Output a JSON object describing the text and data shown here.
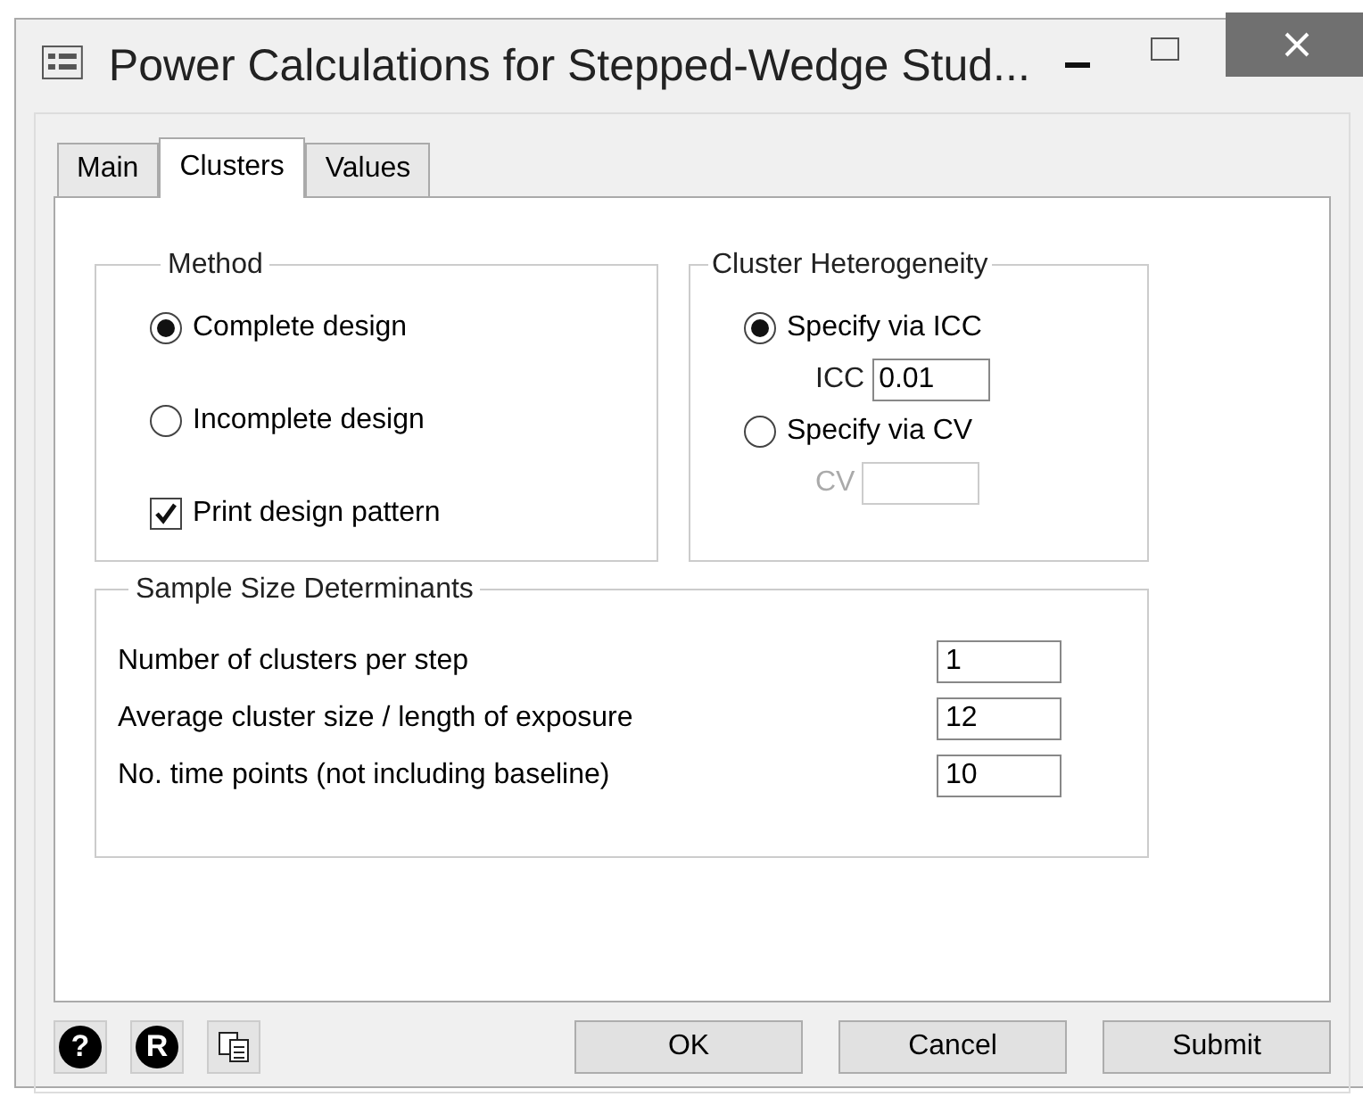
{
  "window": {
    "title": "Power Calculations for Stepped-Wedge Stud..."
  },
  "tabs": [
    {
      "label": "Main",
      "selected": false
    },
    {
      "label": "Clusters",
      "selected": true
    },
    {
      "label": "Values",
      "selected": false
    }
  ],
  "method": {
    "title": "Method",
    "options": [
      {
        "label": "Complete design",
        "selected": true
      },
      {
        "label": "Incomplete design",
        "selected": false
      }
    ],
    "print_pattern": {
      "label": "Print design pattern",
      "checked": true
    }
  },
  "heterogeneity": {
    "title": "Cluster Heterogeneity",
    "options": [
      {
        "label": "Specify via ICC",
        "selected": true,
        "field_label": "ICC",
        "value": "0.01"
      },
      {
        "label": "Specify via CV",
        "selected": false,
        "field_label": "CV"
      }
    ]
  },
  "sample_size": {
    "title": "Sample Size Determinants",
    "rows": [
      {
        "label": "Number of clusters per step",
        "value": "1"
      },
      {
        "label": "Average cluster size / length of exposure",
        "value": "12"
      },
      {
        "label": "No. time points (not including baseline)",
        "value": "10"
      }
    ]
  },
  "tool_icons": [
    "?",
    "R"
  ],
  "buttons": [
    "OK",
    "Cancel",
    "Submit"
  ]
}
